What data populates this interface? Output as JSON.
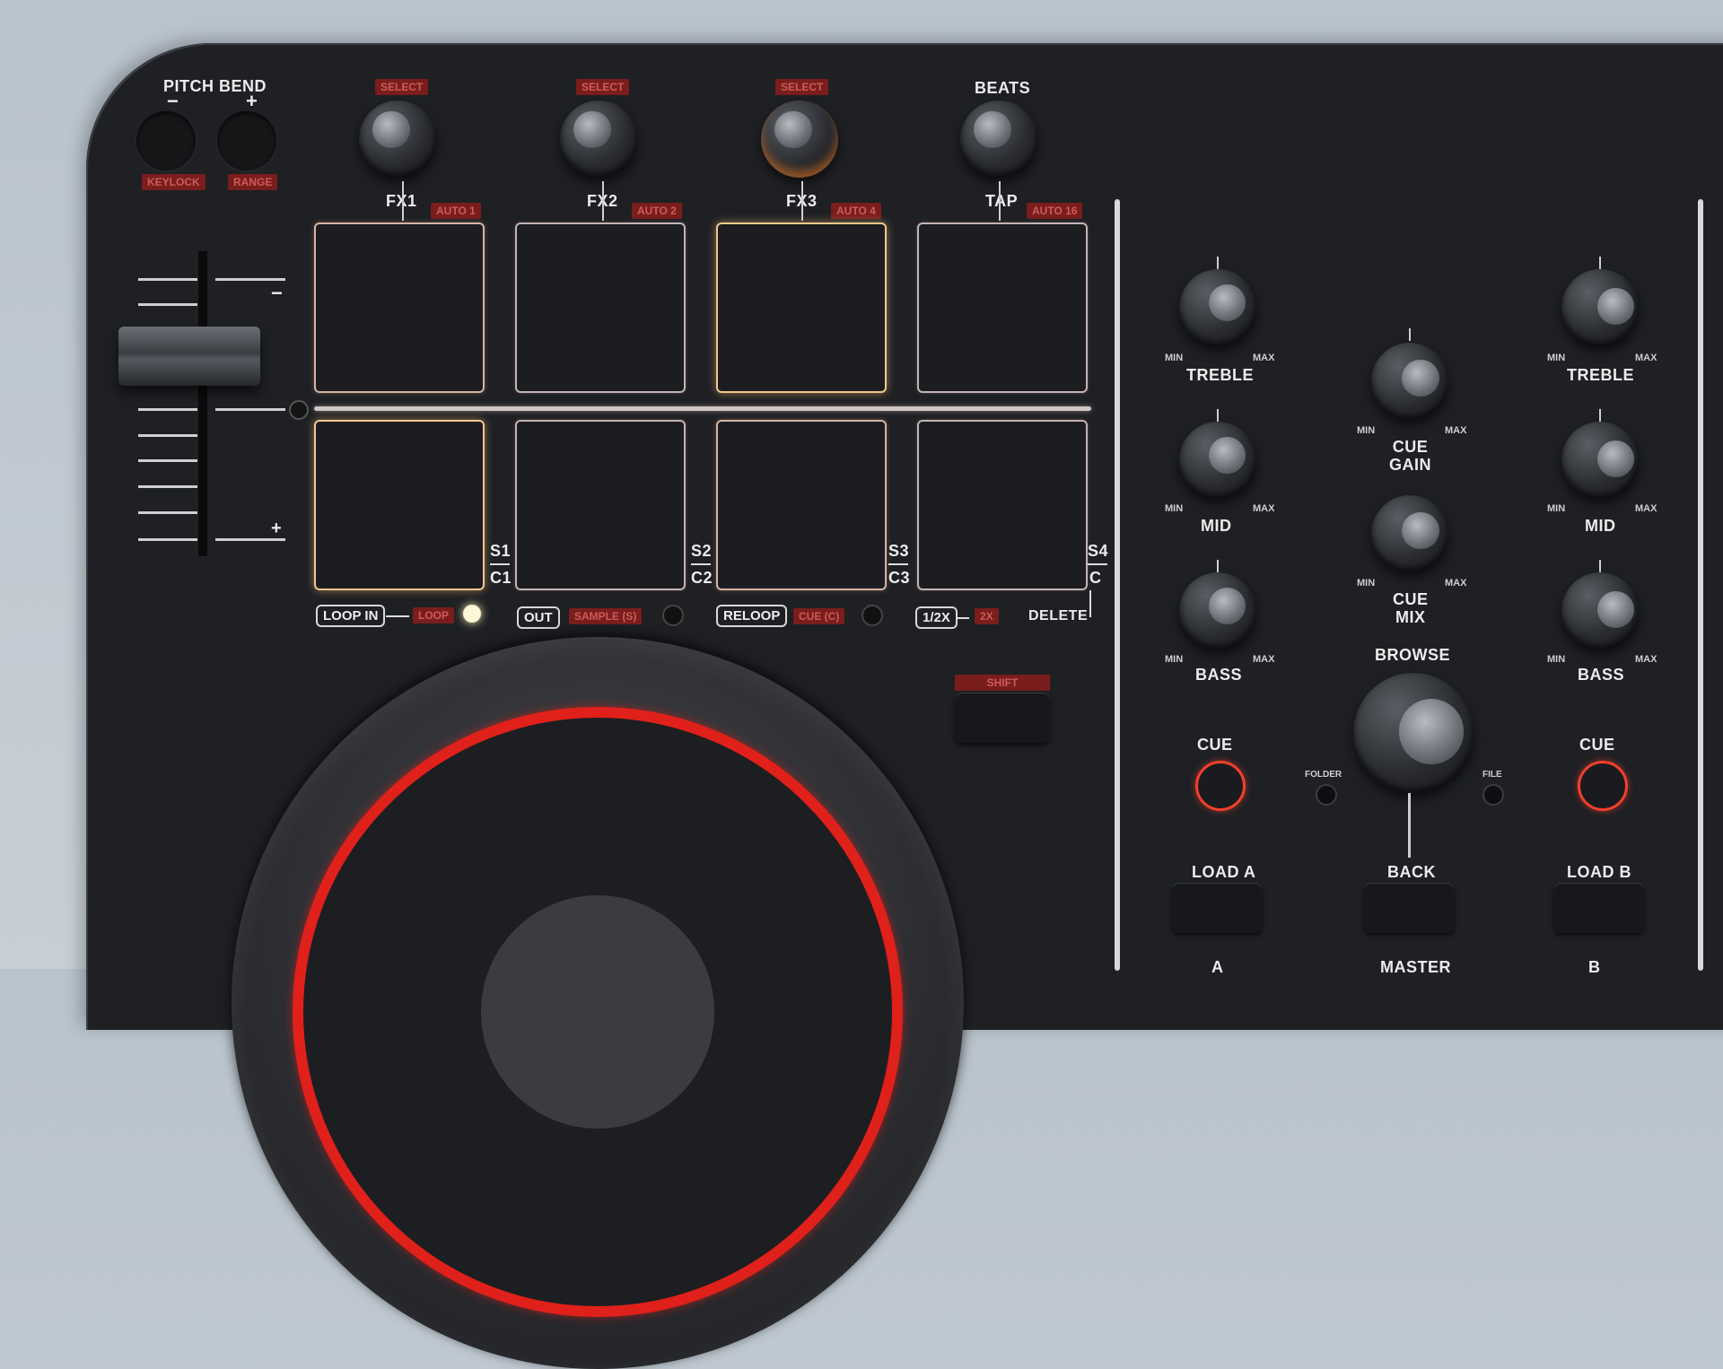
{
  "pitch_bend": {
    "title": "PITCH BEND",
    "minus": "−",
    "plus": "+",
    "keylock": "KEYLOCK",
    "range": "RANGE"
  },
  "fx": [
    {
      "select": "SELECT",
      "label": "FX1",
      "auto": "AUTO 1"
    },
    {
      "select": "SELECT",
      "label": "FX2",
      "auto": "AUTO 2"
    },
    {
      "select": "SELECT",
      "label": "FX3",
      "auto": "AUTO 4"
    }
  ],
  "beats": {
    "title": "BEATS",
    "label": "TAP",
    "auto": "AUTO 16"
  },
  "pitch_fader": {
    "minus": "−",
    "plus": "+"
  },
  "samples": {
    "s1": "S1",
    "c1": "C1",
    "s2": "S2",
    "c2": "C2",
    "s3": "S3",
    "c3": "C3",
    "s4": "S4",
    "c": "C"
  },
  "bottom_row": {
    "loop_in": "LOOP IN",
    "loop": "LOOP",
    "out": "OUT",
    "sample": "SAMPLE (S)",
    "reloop": "RELOOP",
    "cue_c": "CUE (C)",
    "half": "1/2X",
    "two": "2X",
    "delete": "DELETE"
  },
  "shift": "SHIFT",
  "eq_a": {
    "treble": "TREBLE",
    "mid": "MID",
    "bass": "BASS",
    "min": "MIN",
    "max": "MAX"
  },
  "eq_b": {
    "treble": "TREBLE",
    "mid": "MID",
    "bass": "BASS",
    "min": "MIN",
    "max": "MAX"
  },
  "center": {
    "cue_gain": "CUE\nGAIN",
    "cue_mix": "CUE\nMIX",
    "min": "MIN",
    "max": "MAX",
    "browse": "BROWSE",
    "folder": "FOLDER",
    "file": "FILE",
    "back": "BACK",
    "master": "MASTER"
  },
  "cue_a": "CUE",
  "cue_b": "CUE",
  "load_a": "LOAD A",
  "load_b": "LOAD B",
  "deck_a": "A",
  "deck_b": "B",
  "colors": {
    "accent_red": "#e0201a",
    "pad_glow": "#f0c88f",
    "label_red": "#7a1d1d"
  }
}
